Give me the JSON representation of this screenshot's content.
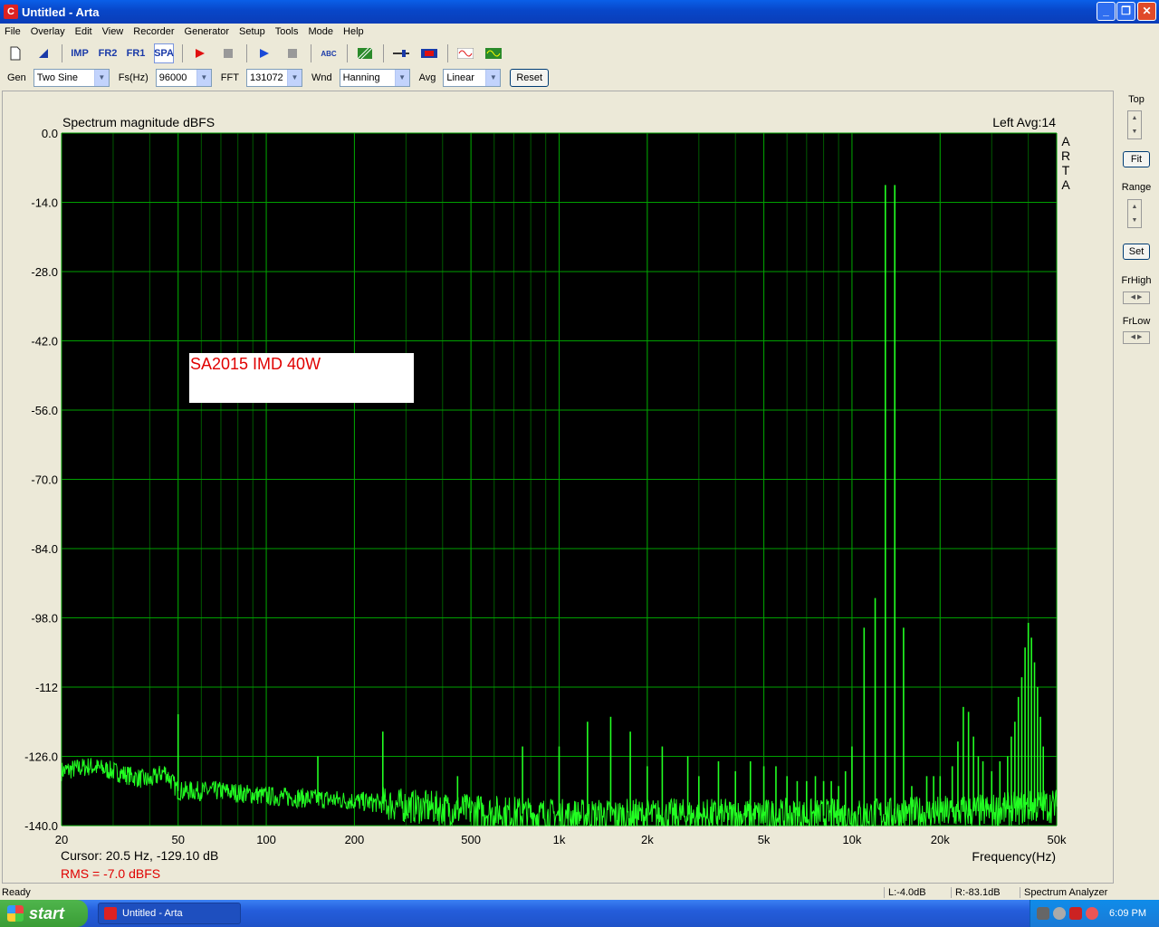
{
  "window": {
    "title": "Untitled - Arta",
    "app_icon": "arta-app-icon"
  },
  "menu": [
    "File",
    "Overlay",
    "Edit",
    "View",
    "Recorder",
    "Generator",
    "Setup",
    "Tools",
    "Mode",
    "Help"
  ],
  "toolbar": {
    "imp": "IMP",
    "fr2": "FR2",
    "fr1": "FR1",
    "spa": "SPA",
    "abc": "ABC"
  },
  "genbar": {
    "gen_label": "Gen",
    "gen_value": "Two Sine",
    "fs_label": "Fs(Hz)",
    "fs_value": "96000",
    "fft_label": "FFT",
    "fft_value": "131072",
    "wnd_label": "Wnd",
    "wnd_value": "Hanning",
    "avg_label": "Avg",
    "avg_value": "Linear",
    "reset_label": "Reset"
  },
  "plot": {
    "header_left": "Spectrum magnitude dBFS",
    "header_right": "Left  Avg:14",
    "brand_vertical": [
      "A",
      "R",
      "T",
      "A"
    ],
    "annotation": "SA2015 IMD 40W",
    "cursor_text": "Cursor:    20.5 Hz, -129.10 dB",
    "rms_text": "RMS =   -7.0 dBFS",
    "colors": {
      "background": "#000000",
      "grid": "#00a000",
      "trace": "#22ff22",
      "annotation": "#e00000"
    }
  },
  "right_panel": {
    "top_label": "Top",
    "fit_label": "Fit",
    "range_label": "Range",
    "set_label": "Set",
    "frhigh_label": "FrHigh",
    "frlow_label": "FrLow"
  },
  "statusbar": {
    "ready": "Ready",
    "l_level": "L:-4.0dB",
    "r_level": "R:-83.1dB",
    "mode": "Spectrum Analyzer"
  },
  "taskbar": {
    "start_label": "start",
    "task_label": "Untitled - Arta",
    "clock": "6:09 PM"
  },
  "chart_data": {
    "type": "line",
    "title": "Spectrum magnitude dBFS",
    "xlabel": "Frequency(Hz)",
    "ylabel": "",
    "x_scale": "log",
    "xlim": [
      20,
      50000
    ],
    "ylim": [
      -140,
      0
    ],
    "y_ticks": [
      "0.0",
      "-14.0",
      "-28.0",
      "-42.0",
      "-56.0",
      "-70.0",
      "-84.0",
      "-98.0",
      "-112",
      "-126.0",
      "-140.0"
    ],
    "y_tick_values": [
      0,
      -14,
      -28,
      -42,
      -56,
      -70,
      -84,
      -98,
      -112,
      -126,
      -140
    ],
    "x_ticks": [
      "20",
      "50",
      "100",
      "200",
      "500",
      "1k",
      "2k",
      "5k",
      "10k",
      "20k",
      "50k"
    ],
    "x_tick_values": [
      20,
      50,
      100,
      200,
      500,
      1000,
      2000,
      5000,
      10000,
      20000,
      50000
    ],
    "grid": true,
    "series": [
      {
        "peaks": [
          [
            50,
            -117.5
          ],
          [
            150,
            -126
          ],
          [
            250,
            -121
          ],
          [
            450,
            -130
          ],
          [
            750,
            -124
          ],
          [
            1000,
            -124
          ],
          [
            1250,
            -119
          ],
          [
            1500,
            -118
          ],
          [
            1750,
            -121
          ],
          [
            2000,
            -128
          ],
          [
            2250,
            -124
          ],
          [
            2750,
            -126
          ],
          [
            3000,
            -130
          ],
          [
            3500,
            -127
          ],
          [
            4000,
            -129
          ],
          [
            4500,
            -127
          ],
          [
            5000,
            -128
          ],
          [
            5500,
            -128
          ],
          [
            6000,
            -130
          ],
          [
            6500,
            -131
          ],
          [
            7000,
            -131
          ],
          [
            7500,
            -130
          ],
          [
            8000,
            -131
          ],
          [
            8500,
            -131
          ],
          [
            9000,
            -132
          ],
          [
            9500,
            -129
          ],
          [
            10000,
            -124
          ],
          [
            11000,
            -100
          ],
          [
            12000,
            -94
          ],
          [
            13000,
            -10.5
          ],
          [
            14000,
            -10.5
          ],
          [
            15000,
            -100
          ],
          [
            16000,
            -132
          ],
          [
            18000,
            -130
          ],
          [
            19000,
            -130
          ],
          [
            20000,
            -130
          ],
          [
            22000,
            -128
          ],
          [
            23000,
            -123
          ],
          [
            24000,
            -116
          ],
          [
            25000,
            -117
          ],
          [
            26000,
            -122
          ],
          [
            27000,
            -126
          ],
          [
            28000,
            -127
          ],
          [
            30000,
            -129
          ],
          [
            32000,
            -127
          ],
          [
            34000,
            -126
          ],
          [
            35000,
            -122
          ],
          [
            36000,
            -119
          ],
          [
            37000,
            -114
          ],
          [
            38000,
            -110
          ],
          [
            39000,
            -104
          ],
          [
            40000,
            -99
          ],
          [
            41000,
            -102
          ],
          [
            42000,
            -107
          ],
          [
            43000,
            -112
          ],
          [
            44000,
            -118
          ],
          [
            45000,
            -124
          ]
        ],
        "noise_floor_db": [
          [
            20,
            -129
          ],
          [
            25,
            -128
          ],
          [
            30,
            -129
          ],
          [
            40,
            -131
          ],
          [
            45,
            -129
          ],
          [
            50,
            -133
          ],
          [
            70,
            -133
          ],
          [
            100,
            -134
          ],
          [
            200,
            -135
          ],
          [
            300,
            -136
          ],
          [
            500,
            -137
          ],
          [
            1000,
            -138
          ],
          [
            5000,
            -138
          ],
          [
            10000,
            -138
          ],
          [
            30000,
            -137
          ],
          [
            45000,
            -136
          ],
          [
            50000,
            -136
          ]
        ]
      }
    ]
  }
}
